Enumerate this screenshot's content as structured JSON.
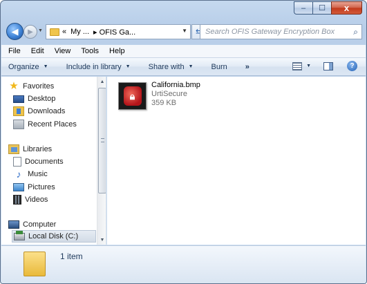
{
  "window": {
    "caption": {
      "minimize": "‒",
      "maximize": "☐",
      "close": "x"
    }
  },
  "address": {
    "separator": "«",
    "crumbs": [
      "My ...",
      "▸ OFIS Ga..."
    ],
    "search_placeholder": "Search OFIS Gateway Encryption Box"
  },
  "menu": [
    "File",
    "Edit",
    "View",
    "Tools",
    "Help"
  ],
  "commands": {
    "organize": "Organize",
    "include_in_library": "Include in library",
    "share_with": "Share with",
    "burn": "Burn",
    "more": "»"
  },
  "nav_pane": {
    "favorites": "Favorites",
    "desktop": "Desktop",
    "downloads": "Downloads",
    "recent_places": "Recent Places",
    "libraries": "Libraries",
    "documents": "Documents",
    "music": "Music",
    "pictures": "Pictures",
    "videos": "Videos",
    "computer": "Computer",
    "local_disk": "Local Disk (C:)"
  },
  "files": [
    {
      "name": "California.bmp",
      "type": "UrtiSecure",
      "size": "359 KB",
      "icon": "lock-icon"
    }
  ],
  "details": {
    "item_count": "1 item"
  },
  "colors": {
    "accent": "#1e395b",
    "lock_red": "#b4141a",
    "close_red": "#c1391b"
  }
}
